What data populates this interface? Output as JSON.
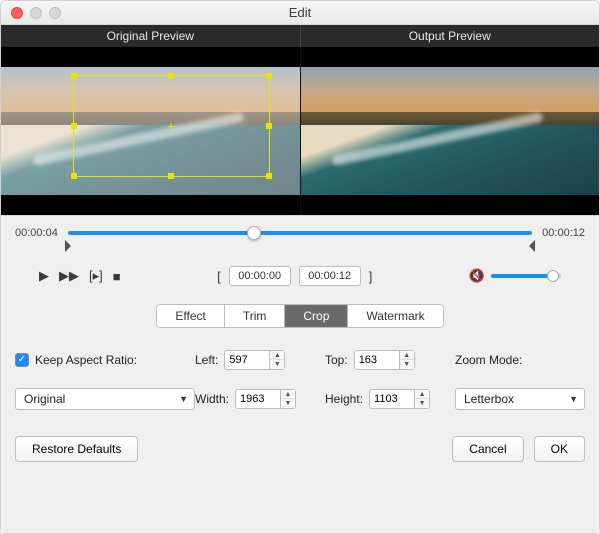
{
  "window": {
    "title": "Edit"
  },
  "preview": {
    "left_label": "Original Preview",
    "right_label": "Output Preview"
  },
  "timeline": {
    "start": "00:00:04",
    "end": "00:00:12",
    "playhead_percent": 40
  },
  "transport": {
    "range_start": "00:00:00",
    "range_end": "00:00:12",
    "volume_percent": 88
  },
  "tabs": {
    "items": [
      "Effect",
      "Trim",
      "Crop",
      "Watermark"
    ],
    "active_index": 2
  },
  "crop": {
    "keep_aspect_label": "Keep Aspect Ratio:",
    "keep_aspect_checked": true,
    "left_label": "Left:",
    "left_value": "597",
    "top_label": "Top:",
    "top_value": "163",
    "width_label": "Width:",
    "width_value": "1963",
    "height_label": "Height:",
    "height_value": "1103",
    "zoom_label": "Zoom Mode:",
    "aspect_dropdown": "Original",
    "zoom_dropdown": "Letterbox"
  },
  "footer": {
    "restore": "Restore Defaults",
    "cancel": "Cancel",
    "ok": "OK"
  },
  "icons": {
    "play": "▶",
    "ff": "▶▶",
    "step": "[▸]",
    "stop": "■",
    "bracket_l": "[",
    "bracket_r": "]",
    "speaker": "🔇",
    "caret": "▼",
    "check": "✓",
    "up": "▲",
    "down": "▼",
    "cross": "+"
  }
}
